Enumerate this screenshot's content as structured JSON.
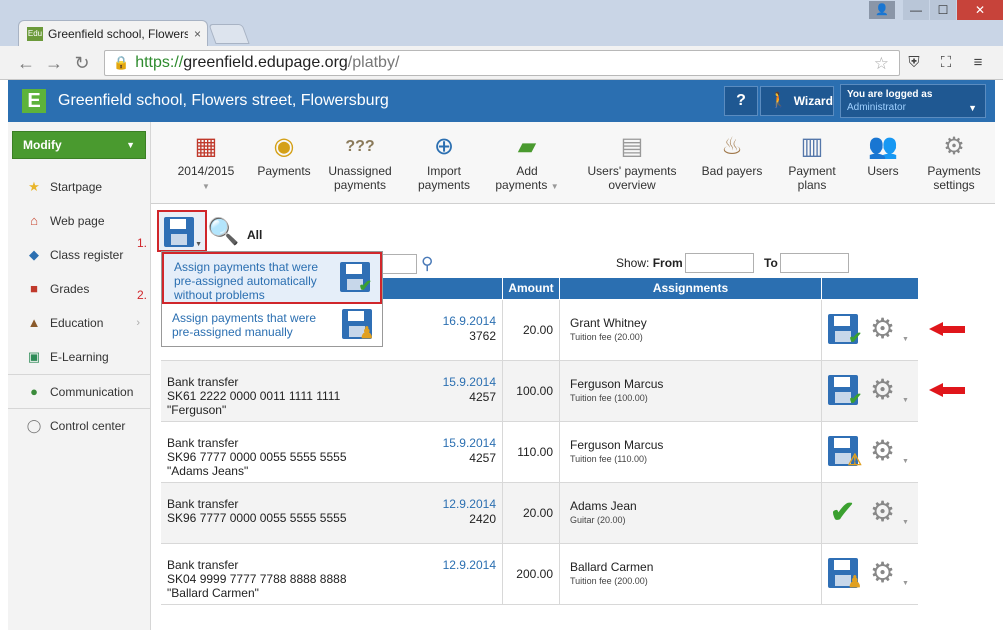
{
  "browser": {
    "tab_title": "Greenfield school, Flowers",
    "favicon_text": "Edu",
    "tab_close": "×",
    "url_https": "https://",
    "url_domain": "greenfield.edupage.org",
    "url_path": "/platby/",
    "win_minimize": "—",
    "win_maximize": "☐",
    "win_close": "✕"
  },
  "header": {
    "logo": "E",
    "school_name": "Greenfield school, Flowers street, Flowersburg",
    "help_label": "?",
    "wizard_label": "Wizard",
    "logged_label": "You are logged as",
    "logged_user": "Administrator"
  },
  "sidebar": {
    "modify_label": "Modify",
    "items": [
      {
        "label": "Startpage",
        "icon": "star-icon"
      },
      {
        "label": "Web page",
        "icon": "house-icon"
      },
      {
        "label": "Class register",
        "icon": "book-icon"
      },
      {
        "label": "Grades",
        "icon": "grades-icon"
      },
      {
        "label": "Education",
        "icon": "education-icon"
      },
      {
        "label": "E-Learning",
        "icon": "elearning-icon"
      },
      {
        "label": "Communication",
        "icon": "communication-icon"
      },
      {
        "label": "Control center",
        "icon": "control-icon"
      }
    ]
  },
  "modules": [
    {
      "l1": "2014/2015",
      "l2": "",
      "icon": "calendar-icon"
    },
    {
      "l1": "Payments",
      "l2": "",
      "icon": "coins-icon"
    },
    {
      "l1": "Unassigned",
      "l2": "payments",
      "icon": "question-bags-icon"
    },
    {
      "l1": "Import",
      "l2": "payments",
      "icon": "import-coins-icon"
    },
    {
      "l1": "Add",
      "l2": "payments",
      "icon": "add-money-icon"
    },
    {
      "l1": "Users' payments",
      "l2": "overview",
      "icon": "overview-icon"
    },
    {
      "l1": "Bad payers",
      "l2": "",
      "icon": "bad-payers-icon"
    },
    {
      "l1": "Payment",
      "l2": "plans",
      "icon": "plans-icon"
    },
    {
      "l1": "Users",
      "l2": "",
      "icon": "users-icon"
    },
    {
      "l1": "Payments",
      "l2": "settings",
      "icon": "settings-icon"
    }
  ],
  "content": {
    "all_label": "All",
    "step1": "1.",
    "step2": "2.",
    "show_label": "Show:",
    "from_label": "From",
    "to_label": "To",
    "dropdown": [
      "Assign payments that were pre-assigned automatically without problems",
      "Assign payments that were pre-assigned manually"
    ]
  },
  "table": {
    "headers": [
      "",
      "Amount",
      "Assignments",
      ""
    ],
    "rows": [
      {
        "desc": [
          "",
          "",
          ""
        ],
        "date": "16.9.2014",
        "num": "3762",
        "amount": "20.00",
        "name": "Grant Whitney",
        "sub": "Tuition fee (20.00)",
        "status": "floppy-check"
      },
      {
        "desc": [
          "Bank transfer",
          "SK61 2222 0000 0011 1111 1111",
          "\"Ferguson\""
        ],
        "date": "15.9.2014",
        "num": "4257",
        "amount": "100.00",
        "name": "Ferguson Marcus",
        "sub": "Tuition fee (100.00)",
        "status": "floppy-check"
      },
      {
        "desc": [
          "Bank transfer",
          "SK96 7777 0000 0055 5555 5555",
          "\"Adams Jeans\""
        ],
        "date": "15.9.2014",
        "num": "4257",
        "amount": "110.00",
        "name": "Ferguson Marcus",
        "sub": "Tuition fee (110.00)",
        "status": "floppy-warning"
      },
      {
        "desc": [
          "Bank transfer",
          "SK96 7777 0000 0055 5555 5555",
          ""
        ],
        "date": "12.9.2014",
        "num": "2420",
        "amount": "20.00",
        "name": "Adams Jean",
        "sub": "Guitar (20.00)",
        "status": "check"
      },
      {
        "desc": [
          "Bank transfer",
          "SK04 9999 7777 7788 8888 8888",
          "\"Ballard Carmen\""
        ],
        "date": "12.9.2014",
        "num": "",
        "amount": "200.00",
        "name": "Ballard Carmen",
        "sub": "Tuition fee (200.00)",
        "status": "floppy-person"
      }
    ]
  },
  "colors": {
    "header_blue": "#2b6fb1",
    "modify_green": "#4a9a2f",
    "highlight_red": "#d0262b",
    "arrow_red": "#e0161b"
  }
}
